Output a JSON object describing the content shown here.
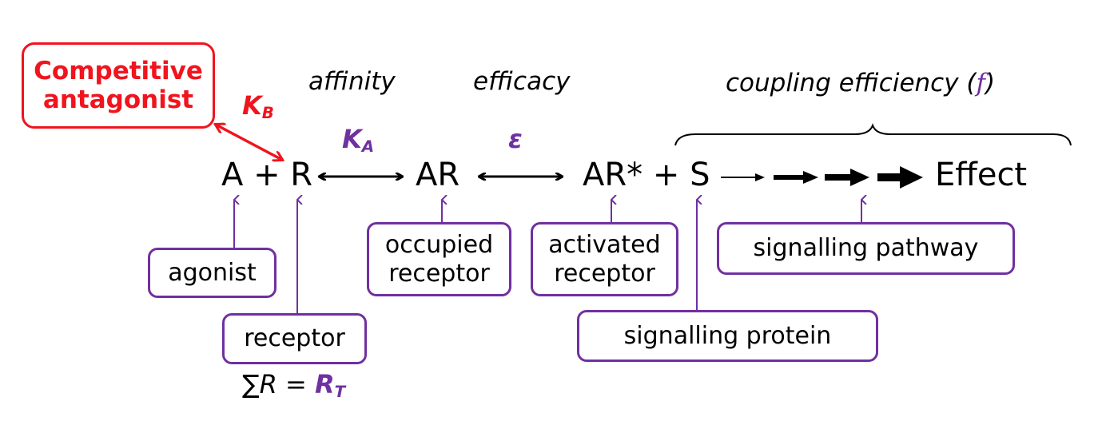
{
  "colors": {
    "antagonist": "#f0141e",
    "annotation": "#7030a0",
    "text": "#000000"
  },
  "antagonist_box": {
    "line1": "Competitive",
    "line2": "antagonist"
  },
  "kb": {
    "main": "K",
    "sub": "B"
  },
  "ka": {
    "main": "K",
    "sub": "A"
  },
  "epsilon": "ε",
  "headers": {
    "affinity": "affinity",
    "efficacy": "efficacy",
    "coupling": "coupling efficiency (",
    "coupling_symbol": "f",
    "coupling_close": ")"
  },
  "equation": {
    "a_plus_r": "A + R",
    "ar": "AR",
    "ar_star_s": "AR* + S",
    "effect": "Effect"
  },
  "labels": {
    "agonist": "agonist",
    "receptor": "receptor",
    "occupied": "occupied receptor",
    "activated": "activated receptor",
    "pathway": "signalling pathway",
    "protein": "signalling protein"
  },
  "total": {
    "lhs": "∑R = ",
    "rt_main": "R",
    "rt_sub": "T"
  }
}
